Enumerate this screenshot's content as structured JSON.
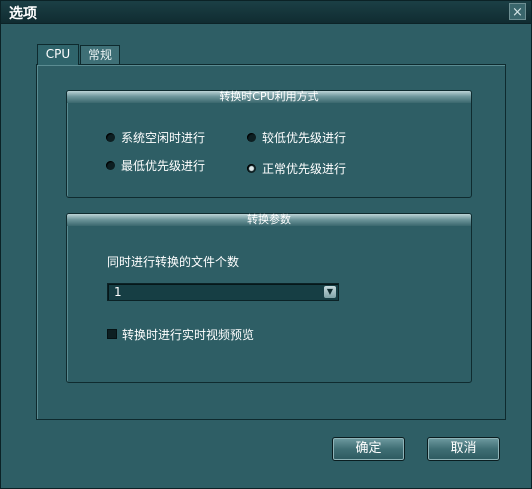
{
  "window": {
    "title": "选项",
    "close_glyph": "×"
  },
  "tabs": [
    {
      "label": "CPU"
    },
    {
      "label": "常规"
    }
  ],
  "cpu_mode": {
    "header": "转换时CPU利用方式",
    "options": [
      {
        "label": "系统空闲时进行",
        "selected": false
      },
      {
        "label": "较低优先级进行",
        "selected": false
      },
      {
        "label": "最低优先级进行",
        "selected": false
      },
      {
        "label": "正常优先级进行",
        "selected": true
      }
    ]
  },
  "convert_params": {
    "header": "转换参数",
    "file_count_label": "同时进行转换的文件个数",
    "file_count_value": "1",
    "preview_label": "转换时进行实时视频预览",
    "preview_checked": false
  },
  "buttons": {
    "ok": "确定",
    "cancel": "取消"
  },
  "icons": {
    "select_arrow": "chevron-down-icon",
    "close": "close-icon"
  }
}
